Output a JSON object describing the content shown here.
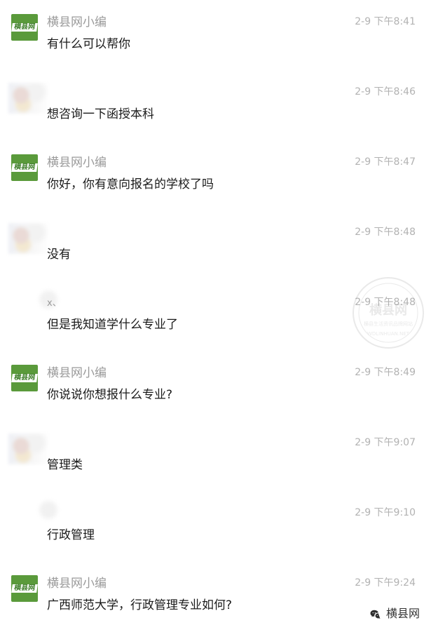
{
  "conversation": [
    {
      "sender_type": "brand",
      "avatar_label": "横县网",
      "name": "横县网小编",
      "time": "2-9 下午8:41",
      "text": "有什么可以帮你"
    },
    {
      "sender_type": "user",
      "avatar_label": "",
      "name": "",
      "time": "2-9 下午8:46",
      "text": "想咨询一下函授本科"
    },
    {
      "sender_type": "brand",
      "avatar_label": "横县网",
      "name": "横县网小编",
      "time": "2-9 下午8:47",
      "text": "你好，你有意向报名的学校了吗"
    },
    {
      "sender_type": "user",
      "avatar_label": "",
      "name": "",
      "time": "2-9 下午8:48",
      "text": "没有"
    },
    {
      "sender_type": "user-light",
      "avatar_label": "",
      "name": "x、",
      "time": "2-9 下午8:48",
      "text": "但是我知道学什么专业了"
    },
    {
      "sender_type": "brand",
      "avatar_label": "横县网",
      "name": "横县网小编",
      "time": "2-9 下午8:49",
      "text": "你说说你想报什么专业?"
    },
    {
      "sender_type": "user",
      "avatar_label": "",
      "name": "",
      "time": "2-9 下午9:07",
      "text": "管理类"
    },
    {
      "sender_type": "user-light",
      "avatar_label": "",
      "name": "",
      "time": "2-9 下午9:10",
      "text": "行政管理"
    },
    {
      "sender_type": "brand",
      "avatar_label": "横县网",
      "name": "横县网小编",
      "time": "2-9 下午9:24",
      "text": "广西师范大学，行政管理专业如何?"
    }
  ],
  "watermark": {
    "title": "横县网",
    "subtitle": "横县生活资讯品牌网站",
    "url": "WDLINHUAN.NET"
  },
  "footer": {
    "icon": "wechat-icon",
    "label": "横县网"
  },
  "colors": {
    "brand_green": "#5a9a3b",
    "name_gray": "#9a9a9a",
    "time_gray": "#b2b2b2",
    "text_dark": "#1a1a1a"
  }
}
